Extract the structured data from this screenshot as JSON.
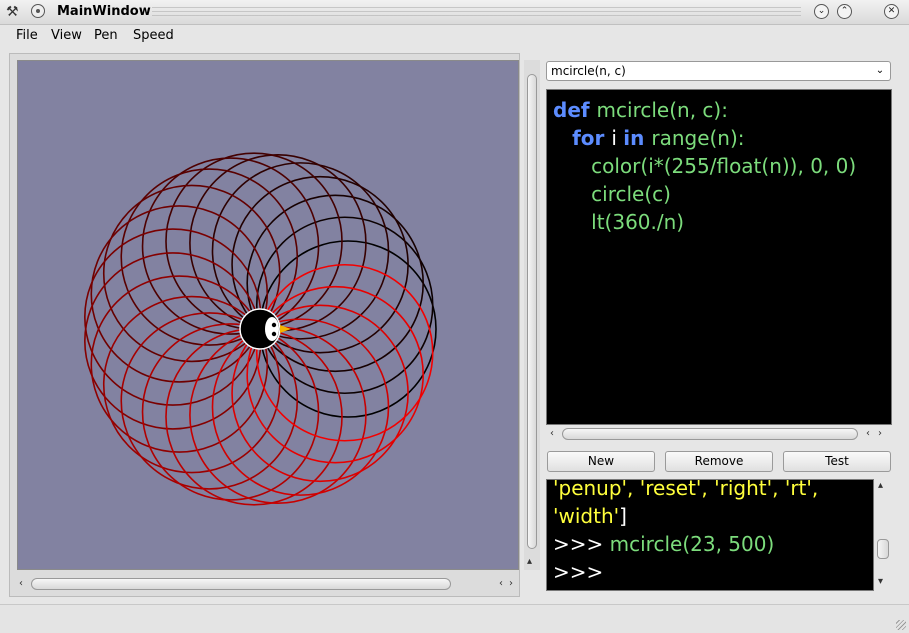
{
  "window": {
    "title": "MainWindow",
    "buttons": {
      "minimize": "⌄",
      "maximize": "⌃",
      "close": "✕"
    }
  },
  "menubar": {
    "items": [
      "File",
      "View",
      "Pen",
      "Speed"
    ]
  },
  "canvas": {
    "background": "#8282a1",
    "drawing": {
      "shape": "rotating circles",
      "circle_count": 23,
      "color_start": "#000000",
      "color_end": "#ff0000"
    },
    "turtle": "penguin-icon"
  },
  "snippet_select": {
    "value": "mcircle(n, c)"
  },
  "editor": {
    "lines": [
      [
        {
          "t": "def ",
          "c": "kw"
        },
        {
          "t": "mcircle(n, c):",
          "c": ""
        }
      ],
      [
        {
          "t": "   "
        },
        {
          "t": "for ",
          "c": "kw"
        },
        {
          "t": "i ",
          "c": "plain"
        },
        {
          "t": "in ",
          "c": "kw"
        },
        {
          "t": "range(n):",
          "c": ""
        }
      ],
      [
        {
          "t": "      color(i*(255/float(n)), 0, 0)",
          "c": ""
        }
      ],
      [
        {
          "t": "      circle(c)",
          "c": ""
        }
      ],
      [
        {
          "t": "      lt(360./n)",
          "c": ""
        }
      ]
    ]
  },
  "buttons": {
    "new": "New",
    "remove": "Remove",
    "test": "Test"
  },
  "console": {
    "lines": [
      [
        {
          "t": "'penup', 'reset', 'right', 'rt',",
          "c": "y"
        }
      ],
      [
        {
          "t": "'width'",
          "c": "y"
        },
        {
          "t": "]",
          "c": "w"
        }
      ],
      [
        {
          "t": ">>> ",
          "c": "w"
        },
        {
          "t": "mcircle(23, 500)",
          "c": "g"
        }
      ],
      [
        {
          "t": ">>> ",
          "c": "w"
        }
      ]
    ]
  }
}
